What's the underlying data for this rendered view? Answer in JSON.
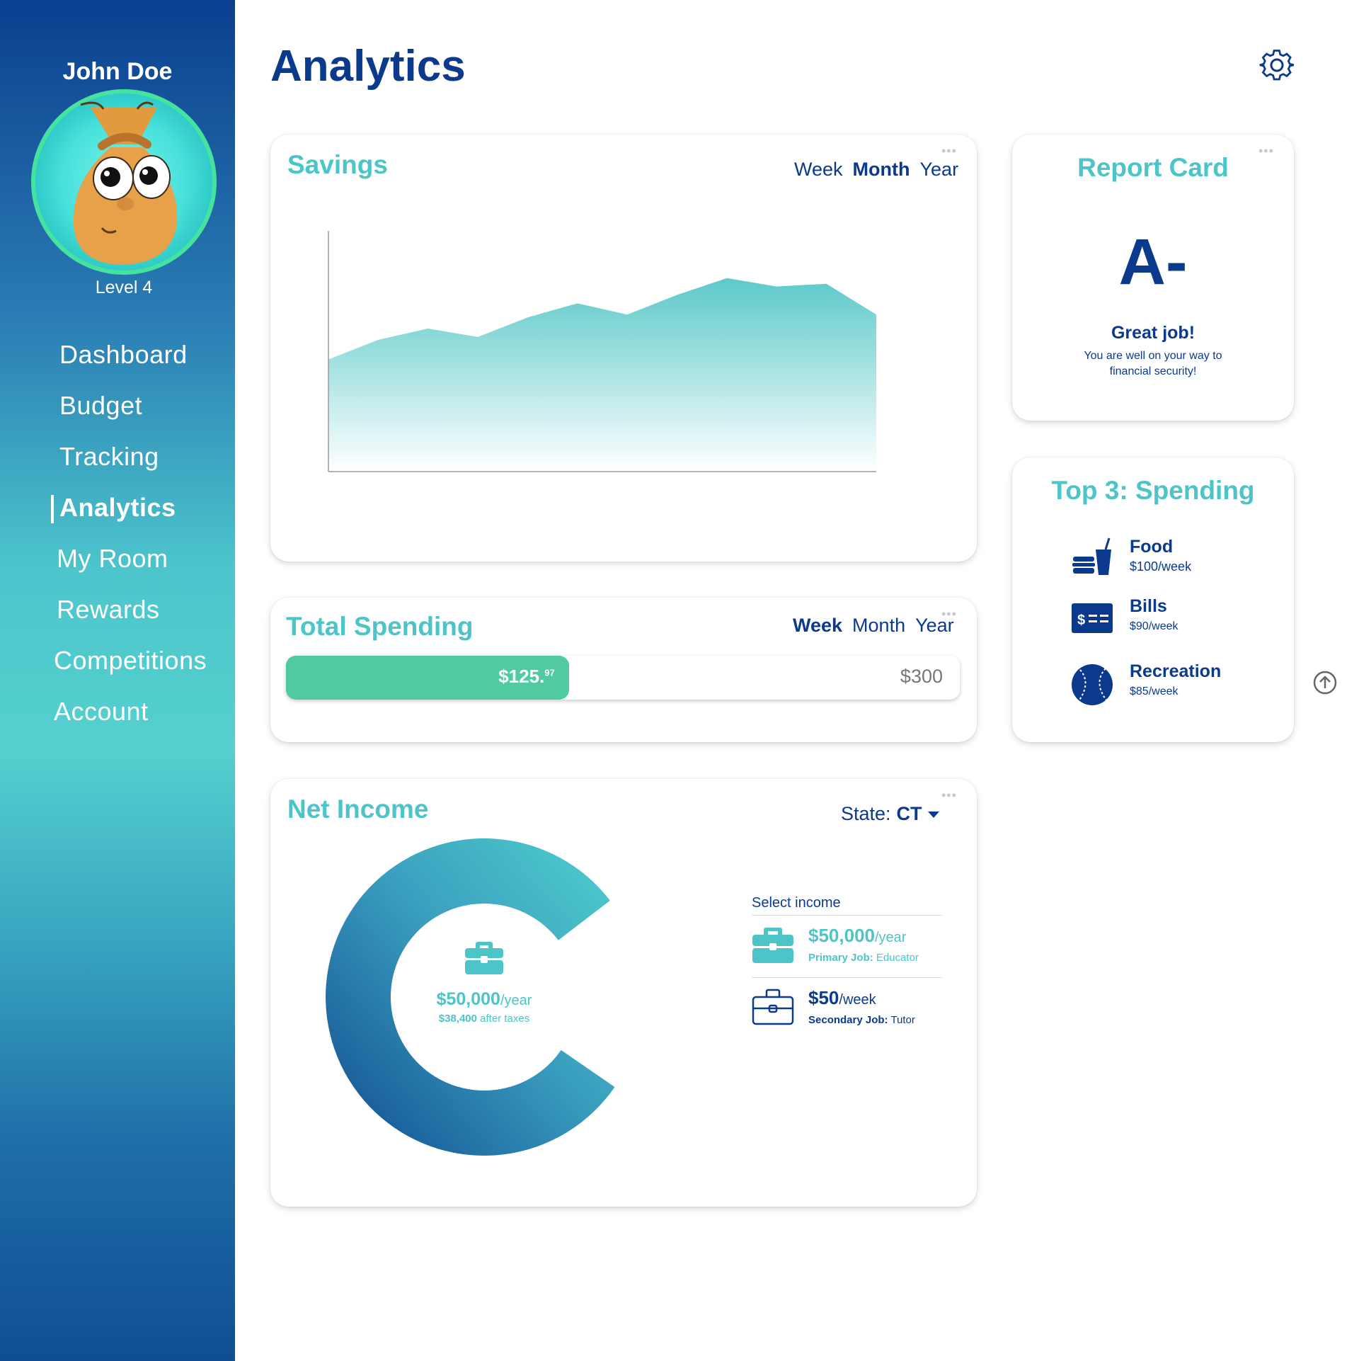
{
  "user": {
    "name": "John Doe",
    "level": "Level 4"
  },
  "nav": {
    "dashboard": "Dashboard",
    "budget": "Budget",
    "tracking": "Tracking",
    "analytics": "Analytics",
    "my_room": "My Room",
    "rewards": "Rewards",
    "competitions": "Competitions",
    "account": "Account"
  },
  "header": {
    "title": "Analytics",
    "settings_icon": "gear-icon"
  },
  "savings": {
    "title": "Savings",
    "periods": [
      "Week",
      "Month",
      "Year"
    ],
    "selected_period": "Month",
    "chart_data": {
      "type": "area",
      "x": [
        0,
        1,
        2,
        3,
        4,
        5,
        6,
        7,
        8,
        9,
        10,
        11
      ],
      "values": [
        40,
        47,
        51,
        48,
        55,
        60,
        56,
        63,
        69,
        66,
        67,
        56
      ],
      "ylim": [
        0,
        100
      ],
      "grid": false,
      "color_top": "#5cc9c9",
      "color_bottom": "#ffffff"
    }
  },
  "spending": {
    "title": "Total Spending",
    "periods": [
      "Week",
      "Month",
      "Year"
    ],
    "selected_period": "Week",
    "spent_main": "$125.",
    "spent_cents": "97",
    "spent_value": 125.97,
    "limit_label": "$300",
    "limit_value": 300,
    "bar_color": "#4fcb9f"
  },
  "income": {
    "title": "Net Income",
    "state_label": "State:",
    "state_value": "CT",
    "center_amount": "$50,000",
    "center_unit": "/year",
    "center_after_amount": "$38,400",
    "center_after_label": "after taxes",
    "select_label": "Select income",
    "donut_fraction": 0.8,
    "sources": [
      {
        "amount": "$50,000",
        "unit": "/year",
        "role": "Primary Job:",
        "job": "Educator",
        "color": "#4cc4c8",
        "icon": "briefcase-filled-icon"
      },
      {
        "amount": "$50",
        "unit": "/week",
        "role": "Secondary Job:",
        "job": "Tutor",
        "color": "#0b3a8c",
        "icon": "briefcase-outline-icon"
      }
    ]
  },
  "report": {
    "title": "Report Card",
    "grade": "A-",
    "headline": "Great job!",
    "message": "You are well on your way to financial security!"
  },
  "top3": {
    "title": "Top 3: Spending",
    "items": [
      {
        "name": "Food",
        "amount": "$100/week",
        "icon": "food-icon"
      },
      {
        "name": "Bills",
        "amount": "$90/week",
        "icon": "bill-icon"
      },
      {
        "name": "Recreation",
        "amount": "$85/week",
        "icon": "baseball-icon"
      }
    ]
  },
  "colors": {
    "accent": "#4cc4c8",
    "primary": "#0b3a8c",
    "success": "#4fcb9f"
  }
}
